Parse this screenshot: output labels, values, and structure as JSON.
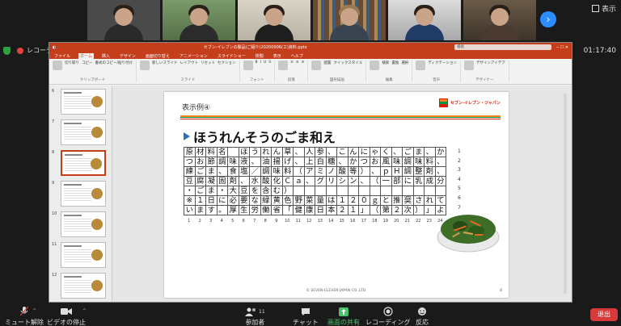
{
  "meeting": {
    "recording_label": "レコーディング中",
    "timer": "01:17:40",
    "view_label": "表示",
    "participant_count": "11"
  },
  "ppt": {
    "window_title": "セブン-イレブンの製品(ご紹介)20200906(工)資料.pptx",
    "search_placeholder": "検索",
    "menu": [
      "ファイル",
      "ホーム",
      "挿入",
      "デザイン",
      "画面切り替え",
      "アニメーション",
      "スライドショー",
      "校閲",
      "表示",
      "ヘルプ"
    ],
    "ribbon_groups": [
      {
        "label": "クリップボード",
        "items": [
          "切り取り",
          "コピー",
          "書式のコピー/貼り付け"
        ]
      },
      {
        "label": "スライド",
        "items": [
          "新しいスライド",
          "レイアウト",
          "リセット",
          "セクション"
        ]
      },
      {
        "label": "フォント",
        "items": [
          "B",
          "I",
          "U",
          "S"
        ]
      },
      {
        "label": "段落",
        "items": [
          "≡",
          "≡",
          "≡"
        ]
      },
      {
        "label": "図形描画",
        "items": [
          "配置",
          "クイックスタイル"
        ]
      },
      {
        "label": "編集",
        "items": [
          "検索",
          "置換",
          "選択"
        ]
      },
      {
        "label": "音声",
        "items": [
          "ディクテーション"
        ]
      },
      {
        "label": "デザイナー",
        "items": [
          "デザインアイデア"
        ]
      }
    ],
    "thumb_numbers": [
      "6",
      "7",
      "8",
      "9",
      "10",
      "11",
      "12"
    ]
  },
  "slide": {
    "title": "表示例④",
    "logo_text": "セブン-イレブン・ジャパン",
    "heading": "ほうれんそうのごま和え",
    "rows": [
      [
        "原",
        "材",
        "料",
        "名",
        "　",
        "ほ",
        "う",
        "れ",
        "ん",
        "草",
        "、",
        "人",
        "参",
        "、",
        "こ",
        "ん",
        "に",
        "ゃ",
        "く",
        "、",
        "ご",
        "ま",
        "、",
        "か"
      ],
      [
        "つ",
        "お",
        "節",
        "調",
        "味",
        "液",
        "、",
        "油",
        "揚",
        "げ",
        "、",
        "上",
        "白",
        "糖",
        "、",
        "か",
        "つ",
        "お",
        "風",
        "味",
        "調",
        "味",
        "料",
        "、"
      ],
      [
        "練",
        "ご",
        "ま",
        "、",
        "食",
        "塩",
        "／",
        "調",
        "味",
        "料",
        "（",
        "ア",
        "ミ",
        "ノ",
        "酸",
        "等",
        "）",
        "、",
        "ｐ",
        "Ｈ",
        "調",
        "整",
        "剤",
        "、"
      ],
      [
        "豆",
        "腐",
        "凝",
        "固",
        "剤",
        "、",
        "水",
        "酸",
        "化",
        "Ｃ",
        "ａ",
        "、",
        "グ",
        "リ",
        "シ",
        "ン",
        "、",
        "（",
        "一",
        "部",
        "に",
        "乳",
        "成",
        "分"
      ],
      [
        "・",
        "ご",
        "ま",
        "・",
        "大",
        "豆",
        "を",
        "含",
        "む",
        "）",
        "",
        "",
        "",
        "",
        "",
        "",
        "",
        "",
        "",
        "",
        "",
        "",
        "",
        ""
      ],
      [
        "※",
        "１",
        "日",
        "に",
        "必",
        "要",
        "な",
        "緑",
        "黄",
        "色",
        "野",
        "菜",
        "量",
        "は",
        "１",
        "２",
        "０",
        "ｇ",
        "と",
        "推",
        "奨",
        "さ",
        "れ",
        "て"
      ],
      [
        "い",
        "ま",
        "す",
        "。",
        "厚",
        "生",
        "労",
        "働",
        "省",
        "「",
        "健",
        "康",
        "日",
        "本",
        "２",
        "１",
        "」",
        "（",
        "第",
        "２",
        "次",
        "）",
        "」",
        "よ",
        "り"
      ]
    ],
    "row_numbers": [
      "1",
      "2",
      "3",
      "4",
      "5",
      "6",
      "7"
    ],
    "col_numbers": [
      "1",
      "2",
      "3",
      "4",
      "5",
      "6",
      "7",
      "8",
      "9",
      "10",
      "11",
      "12",
      "13",
      "14",
      "15",
      "16",
      "17",
      "18",
      "19",
      "20",
      "21",
      "22",
      "23",
      "24"
    ],
    "footer": "© SEVEN-ELEVEN JAPAN CO.,LTD.",
    "page_number": "8"
  },
  "toolbar": {
    "mute": "ミュート解除",
    "video": "ビデオの停止",
    "participants": "参加者",
    "chat": "チャット",
    "share": "画面の共有",
    "record": "レコーディング",
    "reactions": "反応",
    "leave": "退出"
  },
  "colors": {
    "accent_red": "#c43e1c",
    "share_green": "#4ac26b",
    "leave_red": "#d63a3a",
    "zoom_blue": "#2d8cff"
  }
}
